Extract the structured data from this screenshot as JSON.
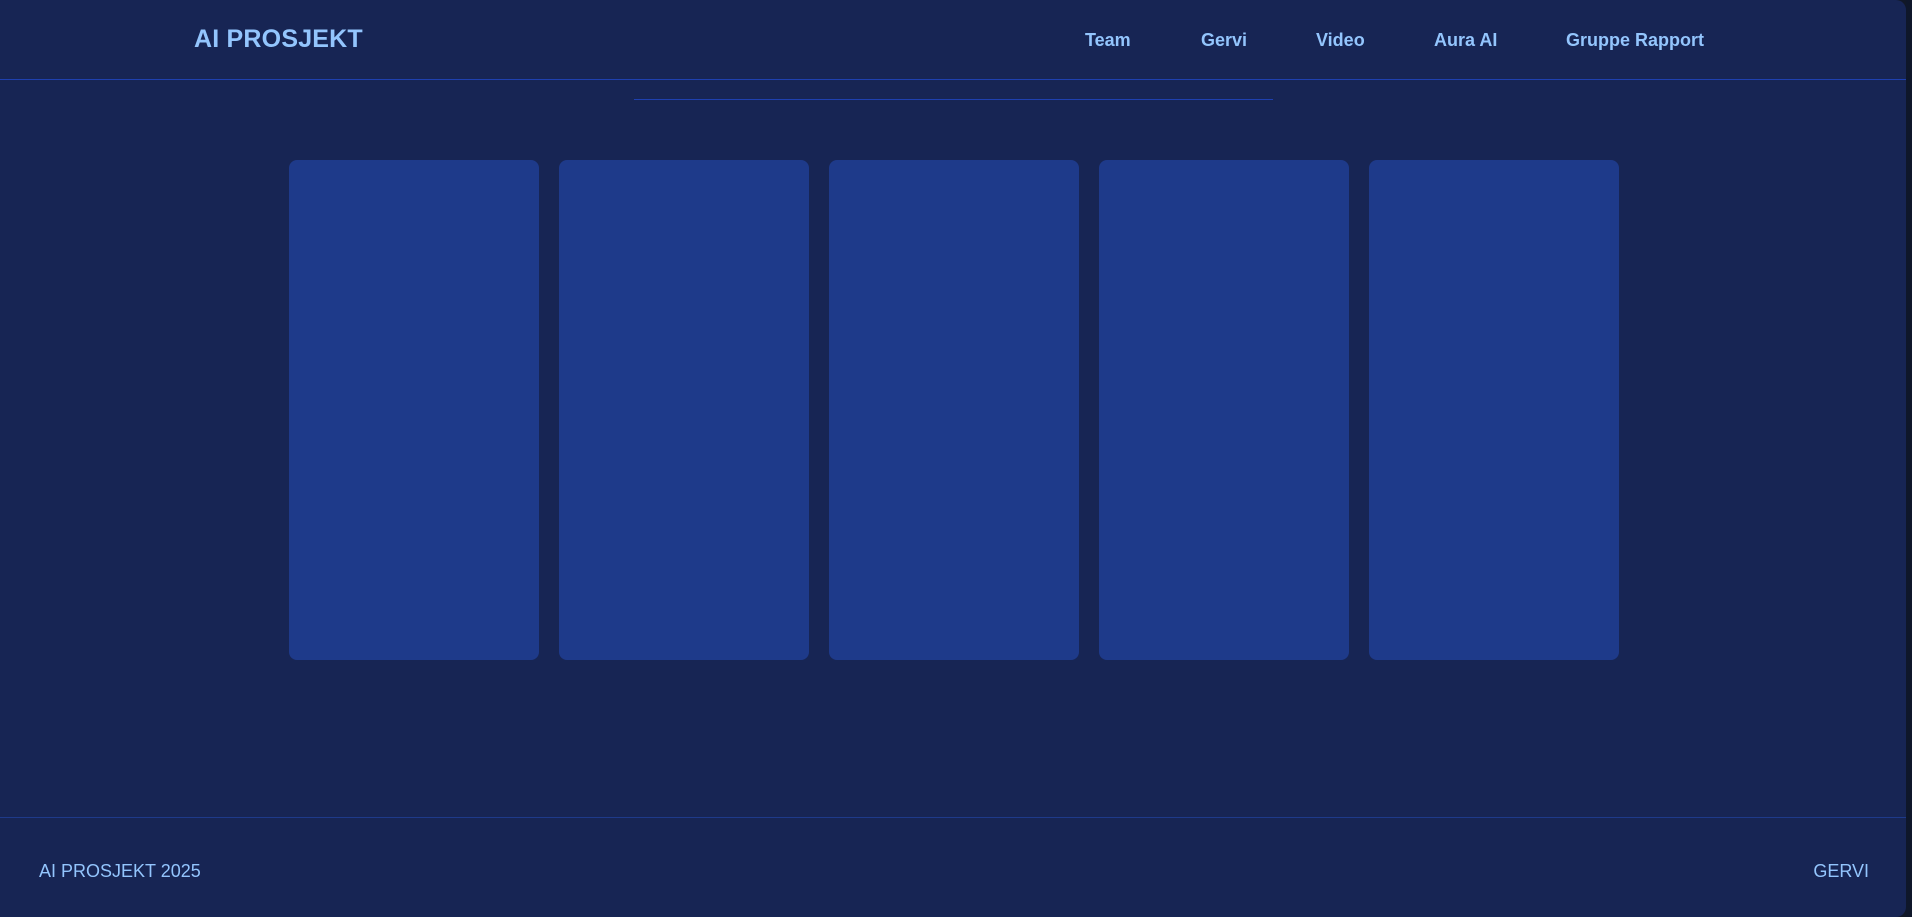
{
  "header": {
    "logo": "AI PROSJEKT",
    "nav": [
      {
        "label": "Team"
      },
      {
        "label": "Gervi"
      },
      {
        "label": "Video"
      },
      {
        "label": "Aura AI"
      },
      {
        "label": "Gruppe Rapport"
      }
    ]
  },
  "main": {
    "cards": [
      {},
      {},
      {},
      {},
      {}
    ]
  },
  "footer": {
    "copyright": "AI PROSJEKT 2025",
    "link": "GERVI"
  },
  "colors": {
    "background": "#172554",
    "card": "#1e3a8a",
    "accent_text": "#93c5fd",
    "border": "#1e40af"
  }
}
